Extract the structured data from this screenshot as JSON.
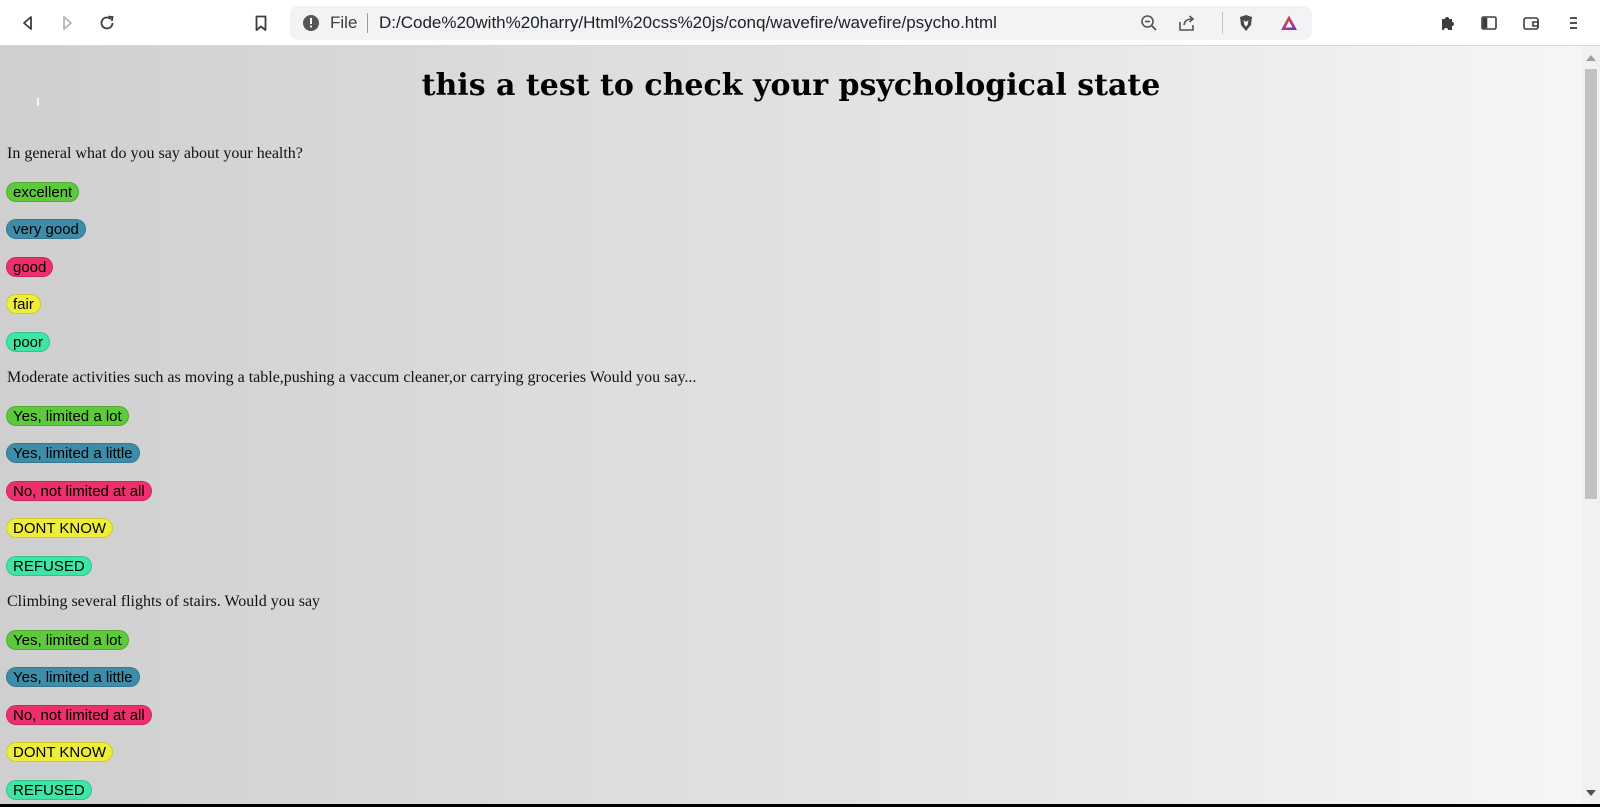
{
  "browser": {
    "url_scheme_label": "File",
    "url": "D:/Code%20with%20harry/Html%20css%20js/conq/wavefire/wavefire/psycho.html",
    "icons": [
      "back-icon",
      "forward-icon",
      "reload-icon",
      "bookmark-icon",
      "info-icon",
      "zoom-out-icon",
      "share-icon",
      "brave-shield-icon",
      "brave-rewards-icon",
      "extensions-icon",
      "sidebar-icon",
      "wallet-icon",
      "menu-icon"
    ]
  },
  "page": {
    "title": "this a test to check your psychological state",
    "questions": [
      {
        "text": "In general what do you say about your health?",
        "options": [
          "excellent",
          "very good",
          "good",
          "fair",
          "poor"
        ]
      },
      {
        "text": "Moderate activities such as moving a table,pushing a vaccum cleaner,or carrying groceries Would you say...",
        "options": [
          "Yes, limited a lot",
          "Yes, limited a little",
          "No, not limited at all",
          "DONT KNOW",
          "REFUSED"
        ]
      },
      {
        "text": "Climbing several flights of stairs. Would you say",
        "options": [
          "Yes, limited a lot",
          "Yes, limited a little",
          "No, not limited at all",
          "DONT KNOW",
          "REFUSED"
        ]
      }
    ],
    "option_colors": [
      "#5dc93b",
      "#3f8ca8",
      "#ee2f6c",
      "#eeee3a",
      "#3ee6a6"
    ]
  }
}
